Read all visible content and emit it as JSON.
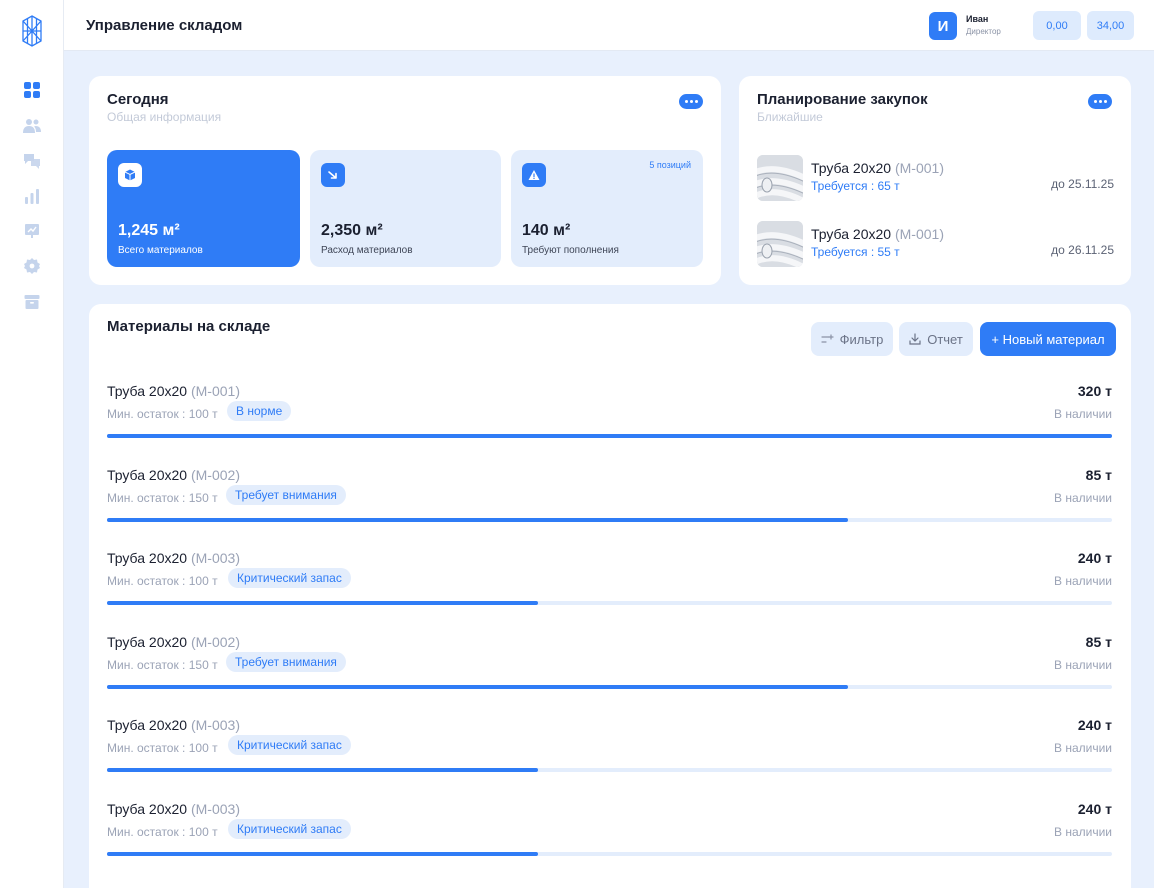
{
  "header": {
    "title": "Управление складом",
    "user": {
      "initial": "И",
      "name": "Иван",
      "role": "Директор"
    },
    "chips": [
      "0,00",
      "34,00"
    ]
  },
  "sidebar": {
    "icons": [
      "dashboard-icon",
      "users-icon",
      "chat-icon",
      "bar-chart-icon",
      "presentation-icon",
      "settings-icon",
      "archive-icon"
    ]
  },
  "today": {
    "title": "Сегодня",
    "subtitle": "Общая информация",
    "stats": [
      {
        "icon": "box-icon",
        "value": "1,245 м²",
        "label": "Всего материалов",
        "badge": ""
      },
      {
        "icon": "trend-down-icon",
        "value": "2,350 м²",
        "label": "Расход материалов",
        "badge": ""
      },
      {
        "icon": "warning-icon",
        "value": "140 м²",
        "label": "Требуют пополнения",
        "badge": "5 позиций"
      }
    ]
  },
  "planning": {
    "title": "Планирование закупок",
    "subtitle": "Ближайшие",
    "items": [
      {
        "name": "Труба 20x20",
        "code": "(М-001)",
        "required": "Требуется : 65 т",
        "date": "до 25.11.25"
      },
      {
        "name": "Труба 20x20",
        "code": "(М-001)",
        "required": "Требуется : 55 т",
        "date": "до 26.11.25"
      }
    ]
  },
  "materials": {
    "title": "Материалы на складе",
    "filter_label": "Фильтр",
    "report_label": "Отчет",
    "new_label": "+ Новый материал",
    "rows": [
      {
        "name": "Труба 20x20",
        "code": "(М-001)",
        "min": "Мин. остаток : 100 т",
        "tag": "В норме",
        "qty": "320 т",
        "avail": "В наличии",
        "level": 1.0
      },
      {
        "name": "Труба 20x20",
        "code": "(М-002)",
        "min": "Мин. остаток : 150 т",
        "tag": "Требует внимания",
        "qty": "85 т",
        "avail": "В наличии",
        "level": 0.737
      },
      {
        "name": "Труба 20x20",
        "code": "(М-003)",
        "min": "Мин. остаток : 100 т",
        "tag": "Критический запас",
        "qty": "240 т",
        "avail": "В наличии",
        "level": 0.429
      },
      {
        "name": "Труба 20x20",
        "code": "(М-002)",
        "min": "Мин. остаток : 150 т",
        "tag": "Требует внимания",
        "qty": "85 т",
        "avail": "В наличии",
        "level": 0.737
      },
      {
        "name": "Труба 20x20",
        "code": "(М-003)",
        "min": "Мин. остаток : 100 т",
        "tag": "Критический запас",
        "qty": "240 т",
        "avail": "В наличии",
        "level": 0.429
      },
      {
        "name": "Труба 20x20",
        "code": "(М-003)",
        "min": "Мин. остаток : 100 т",
        "tag": "Критический запас",
        "qty": "240 т",
        "avail": "В наличии",
        "level": 0.429
      }
    ]
  },
  "colors": {
    "accent": "#2f7cf6",
    "tint": "#e3edfc",
    "background": "#e8f0fd"
  }
}
